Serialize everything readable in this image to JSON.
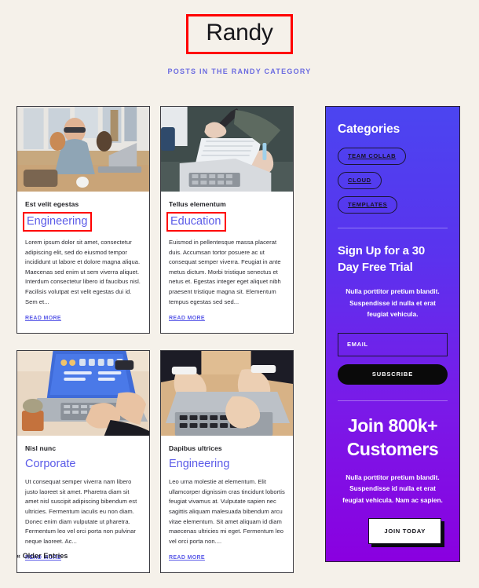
{
  "header": {
    "title": "Randy",
    "subtitle": "POSTS IN THE RANDY CATEGORY",
    "highlight_color": "#ff0000"
  },
  "theme": {
    "page_background": "#f5f1ea",
    "link_color": "#5b5be8",
    "sidebar_gradient_start": "#4b45f0",
    "sidebar_gradient_end": "#8a00e0",
    "button_black": "#0a0a0a"
  },
  "posts": [
    {
      "kicker": "Est velit egestas",
      "category": "Engineering",
      "highlighted": true,
      "excerpt": "Lorem ipsum dolor sit amet, consectetur adipiscing elit, sed do eiusmod tempor incididunt ut labore et dolore magna aliqua. Maecenas sed enim ut sem viverra aliquet. Interdum consectetur libero id faucibus nisl. Facilisis volutpat est velit egestas dui id. Sem et...",
      "read_more": "READ MORE",
      "image_alt": "man-with-glasses-working-on-laptop-in-cafe"
    },
    {
      "kicker": "Tellus elementum",
      "category": "Education",
      "highlighted": true,
      "excerpt": "Euismod in pellentesque massa placerat duis. Accumsan tortor posuere ac ut consequat semper viverra. Feugiat in ante metus dictum. Morbi tristique senectus et netus et. Egestas integer eget aliquet nibh praesent tristique magna sit. Elementum tempus egestas sed sed...",
      "read_more": "READ MORE",
      "image_alt": "hands-writing-in-notebook-beside-laptop"
    },
    {
      "kicker": "Nisl nunc",
      "category": "Corporate",
      "highlighted": false,
      "excerpt": "Ut consequat semper viverra nam libero justo laoreet sit amet. Pharetra diam sit amet nisl suscipit adipiscing bibendum est ultricies. Fermentum iaculis eu non diam. Donec enim diam vulputate ut pharetra. Fermentum leo vel orci porta non pulvinar neque laoreet. Ac...",
      "read_more": "READ MORE",
      "image_alt": "laptop-on-desk-with-hands-typing-and-plant"
    },
    {
      "kicker": "Dapibus ultrices",
      "category": "Engineering",
      "highlighted": false,
      "excerpt": "Leo urna molestie at elementum. Elit ullamcorper dignissim cras tincidunt lobortis feugiat vivamus at. Vulputate sapien nec sagittis aliquam malesuada bibendum arcu vitae elementum. Sit amet aliquam id diam maecenas ultricies mi eget. Fermentum leo vel orci porta non....",
      "read_more": "READ MORE",
      "image_alt": "overhead-hands-typing-on-laptop-keyboard"
    }
  ],
  "sidebar": {
    "categories_heading": "Categories",
    "categories": [
      {
        "label": "TEAM COLLAB"
      },
      {
        "label": "CLOUD"
      },
      {
        "label": "TEMPLATES"
      }
    ],
    "signup": {
      "title": "Sign Up for a 30 Day Free Trial",
      "text": "Nulla porttitor pretium blandit. Suspendisse id nulla et erat feugiat vehicula.",
      "email_placeholder": "EMAIL",
      "email_value": "",
      "subscribe_label": "SUBSCRIBE"
    },
    "join": {
      "title": "Join 800k+ Customers",
      "text": "Nulla porttitor pretium blandit. Suspendisse id nulla et erat feugiat vehicula. Nam ac sapien.",
      "button_label": "JOIN TODAY"
    }
  },
  "footer": {
    "older_entries": "« Older Entries"
  }
}
